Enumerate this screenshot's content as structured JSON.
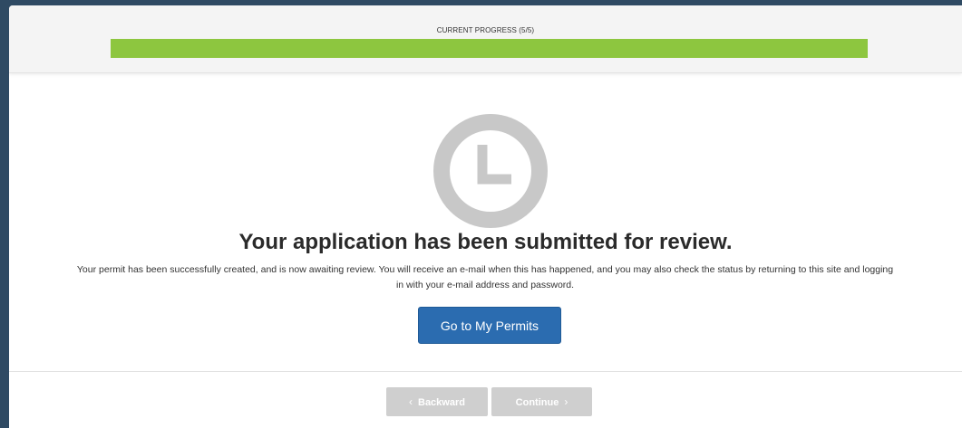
{
  "progress": {
    "label": "CURRENT PROGRESS (5/5)",
    "current_step": 5,
    "total_steps": 5,
    "fill_fraction": 1.0,
    "fill_color": "#8dc63f"
  },
  "status": {
    "icon": "clock-icon",
    "icon_color": "#c8c8c8",
    "headline": "Your application has been submitted for review.",
    "message": "Your permit has been successfully created, and is now awaiting review. You will receive an e-mail when this has happened, and you may also check the status by returning to this site and logging in with your e-mail address and password."
  },
  "actions": {
    "primary_label": "Go to My Permits",
    "primary_color": "#2b6cb0"
  },
  "footer": {
    "backward_label": "Backward",
    "continue_label": "Continue",
    "backward_icon": "chevron-left-icon",
    "continue_icon": "chevron-right-icon",
    "disabled_color": "#cfcfcf"
  }
}
